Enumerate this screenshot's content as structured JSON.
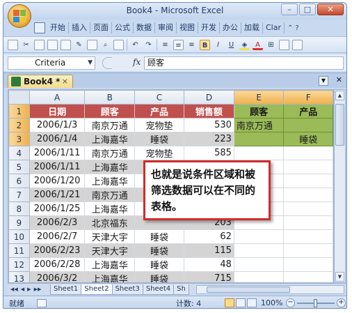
{
  "window": {
    "title": "Book4 - Microsoft Excel",
    "controls": [
      "–",
      "□",
      "✕"
    ]
  },
  "ribbon_tabs": [
    "开始",
    "插入",
    "页面",
    "公式",
    "数据",
    "审阅",
    "视图",
    "开发",
    "办公",
    "加载",
    "Clar"
  ],
  "formula_bar": {
    "name_box": "Criteria",
    "fx_label": "fx",
    "value": "顾客"
  },
  "workbook_tab": {
    "label": "Book4 *",
    "close": "×"
  },
  "grid": {
    "columns": [
      "A",
      "B",
      "C",
      "D",
      "E",
      "F"
    ],
    "rows": [
      {
        "num": "1",
        "a": "日期",
        "b": "顾客",
        "c": "产品",
        "d": "销售额",
        "e": "顾客",
        "f": "产品"
      },
      {
        "num": "2",
        "a": "2006/1/3",
        "b": "南京万通",
        "c": "宠物垫",
        "d": "530",
        "e": "南京万通",
        "f": ""
      },
      {
        "num": "3",
        "a": "2006/1/4",
        "b": "上海嘉华",
        "c": "睡袋",
        "d": "223",
        "e": "",
        "f": "睡袋"
      },
      {
        "num": "4",
        "a": "2006/1/11",
        "b": "南京万通",
        "c": "宠物垫",
        "d": "585",
        "e": "",
        "f": ""
      },
      {
        "num": "5",
        "a": "2006/1/11",
        "b": "上海嘉华",
        "c": "",
        "d": "",
        "e": "",
        "f": ""
      },
      {
        "num": "6",
        "a": "2006/1/20",
        "b": "上海嘉华",
        "c": "",
        "d": "",
        "e": "",
        "f": ""
      },
      {
        "num": "7",
        "a": "2006/1/21",
        "b": "南京万通",
        "c": "",
        "d": "",
        "e": "",
        "f": ""
      },
      {
        "num": "8",
        "a": "2006/1/25",
        "b": "上海嘉华",
        "c": "",
        "d": "",
        "e": "",
        "f": ""
      },
      {
        "num": "9",
        "a": "2006/2/3",
        "b": "北京福东",
        "c": "",
        "d": "203",
        "e": "",
        "f": ""
      },
      {
        "num": "10",
        "a": "2006/2/7",
        "b": "天津大宇",
        "c": "睡袋",
        "d": "62",
        "e": "",
        "f": ""
      },
      {
        "num": "11",
        "a": "2006/2/23",
        "b": "天津大宇",
        "c": "睡袋",
        "d": "115",
        "e": "",
        "f": ""
      },
      {
        "num": "12",
        "a": "2006/2/28",
        "b": "上海嘉华",
        "c": "睡袋",
        "d": "48",
        "e": "",
        "f": ""
      },
      {
        "num": "13",
        "a": "2006/3/2",
        "b": "上海嘉华",
        "c": "睡袋",
        "d": "715",
        "e": "",
        "f": ""
      }
    ]
  },
  "callout": {
    "text": "也就是说条件区域和被筛选数据可以在不同的表格。"
  },
  "sheet_tabs": [
    "Sheet1",
    "Sheet2",
    "Sheet3",
    "Sheet4",
    "Sh"
  ],
  "sheet_nav": [
    "◀◀",
    "◀",
    "▶",
    "▶▶"
  ],
  "status": {
    "ready": "就绪",
    "count": "计数: 4",
    "zoom": "100%"
  },
  "colors": {
    "header_fill": "#c0504d",
    "criteria_fill": "#9bbb59",
    "callout_border": "#d22b2b",
    "selected_header": "#f1b04c"
  }
}
